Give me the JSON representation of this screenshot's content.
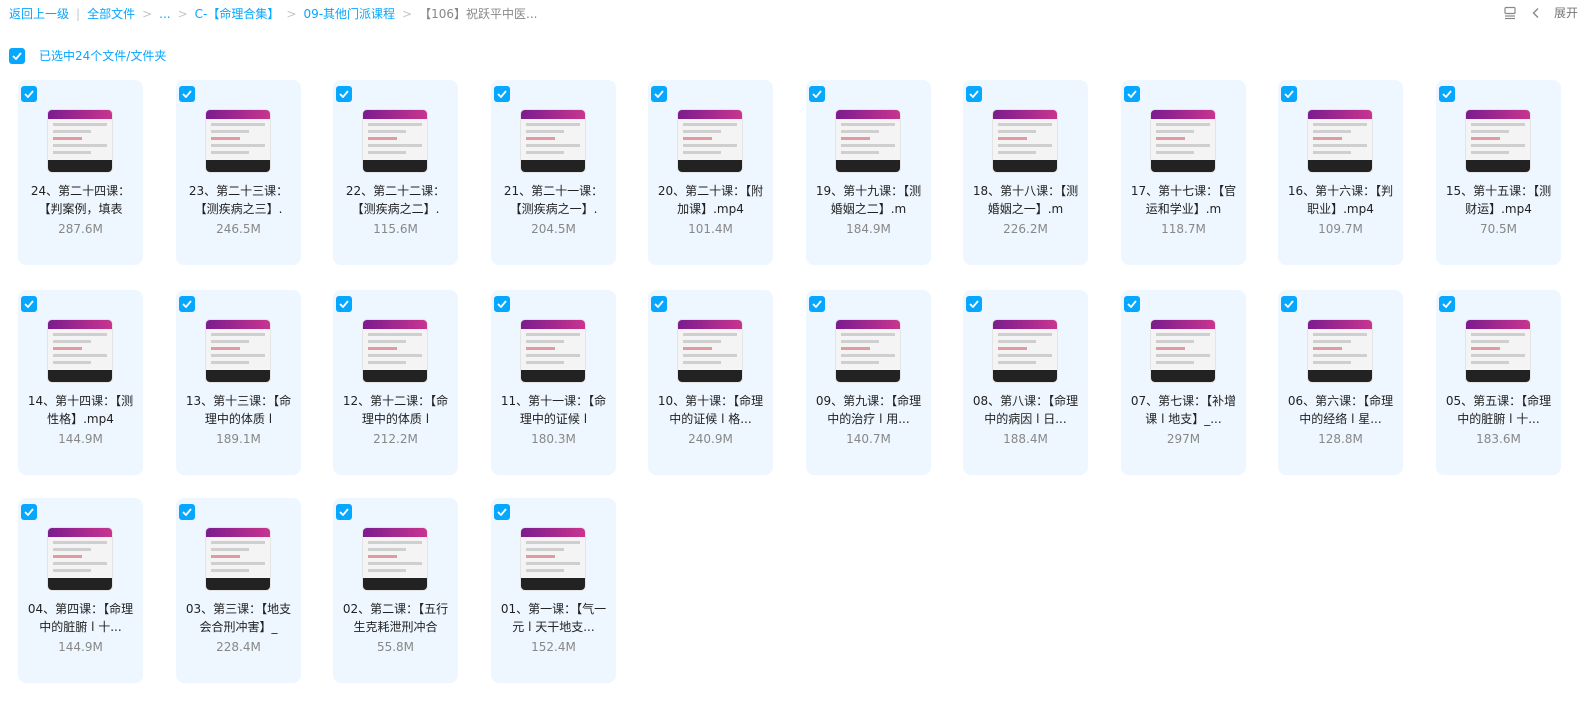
{
  "breadcrumb": {
    "back": "返回上一级",
    "items": [
      "全部文件",
      "...",
      "C-【命理合集】",
      "09-其他门派课程"
    ],
    "current": "【106】祝跃平中医..."
  },
  "toolbar": {
    "expand_label": "展开"
  },
  "selection": {
    "text": "已选中24个文件/文件夹"
  },
  "files": [
    {
      "name": "24、第二十四课：【判案例，填表",
      "size": "287.6M"
    },
    {
      "name": "23、第二十三课：【测疾病之三】.",
      "size": "246.5M"
    },
    {
      "name": "22、第二十二课：【测疾病之二】.",
      "size": "115.6M"
    },
    {
      "name": "21、第二十一课：【测疾病之一】.",
      "size": "204.5M"
    },
    {
      "name": "20、第二十课：【附加课】.mp4",
      "size": "101.4M"
    },
    {
      "name": "19、第十九课：【测婚姻之二】.m",
      "size": "184.9M"
    },
    {
      "name": "18、第十八课：【测婚姻之一】.m",
      "size": "226.2M"
    },
    {
      "name": "17、第十七课：【官运和学业】.m",
      "size": "118.7M"
    },
    {
      "name": "16、第十六课：【判职业】.mp4",
      "size": "109.7M"
    },
    {
      "name": "15、第十五课：【测财运】.mp4",
      "size": "70.5M"
    },
    {
      "name": "14、第十四课：【测性格】.mp4",
      "size": "144.9M"
    },
    {
      "name": "13、第十三课：【命理中的体质 l",
      "size": "189.1M"
    },
    {
      "name": "12、第十二课：【命理中的体质 l",
      "size": "212.2M"
    },
    {
      "name": "11、第十一课：【命理中的证候 l",
      "size": "180.3M"
    },
    {
      "name": "10、第十课：【命理中的证候 l 格...",
      "size": "240.9M"
    },
    {
      "name": "09、第九课：【命理中的治疗 l 用...",
      "size": "140.7M"
    },
    {
      "name": "08、第八课：【命理中的病因 l 日...",
      "size": "188.4M"
    },
    {
      "name": "07、第七课：【补增课 l 地支】_...",
      "size": "297M"
    },
    {
      "name": "06、第六课：【命理中的经络 l 星...",
      "size": "128.8M"
    },
    {
      "name": "05、第五课：【命理中的脏腑 l 十...",
      "size": "183.6M"
    },
    {
      "name": "04、第四课：【命理中的脏腑 l 十...",
      "size": "144.9M"
    },
    {
      "name": "03、第三课：【地支会合刑冲害】_",
      "size": "228.4M"
    },
    {
      "name": "02、第二课：【五行生克耗泄刑冲合",
      "size": "55.8M"
    },
    {
      "name": "01、第一课：【气一元 l 天干地支...",
      "size": "152.4M"
    }
  ]
}
